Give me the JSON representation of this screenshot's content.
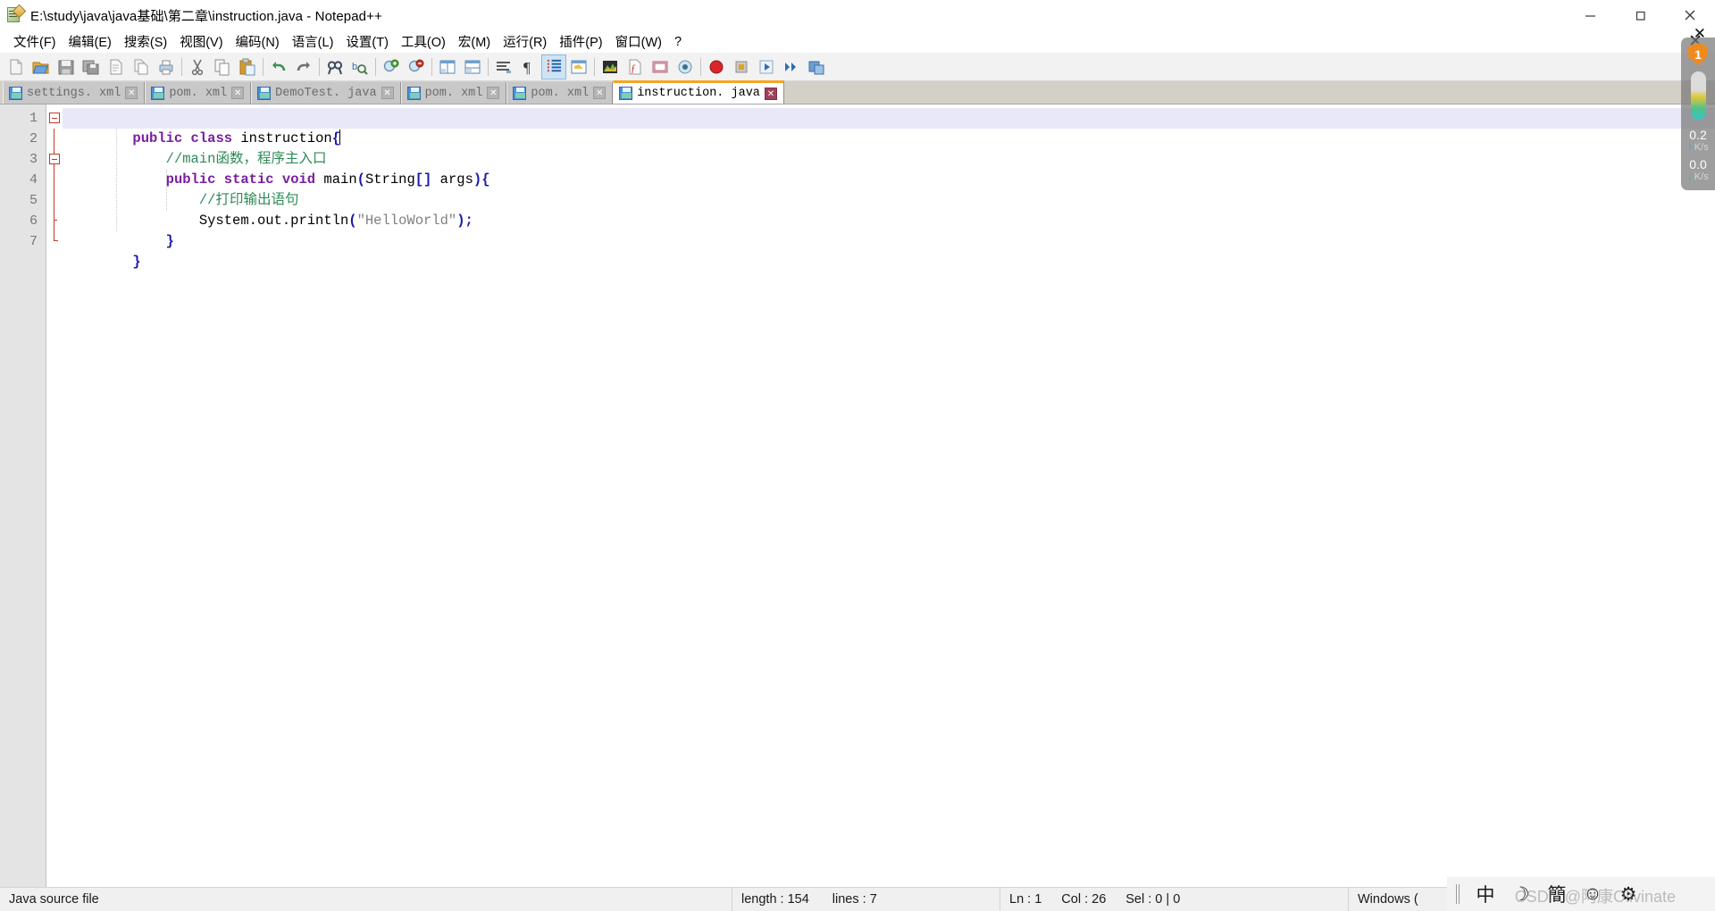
{
  "window": {
    "title": "E:\\study\\java\\java基础\\第二章\\instruction.java - Notepad++",
    "icon": "notepadpp-icon",
    "minimize_label": "—",
    "maximize_label": "▢",
    "close_label": "✕"
  },
  "menu": {
    "items": [
      {
        "label": "文件(F)",
        "name": "menu-file"
      },
      {
        "label": "编辑(E)",
        "name": "menu-edit"
      },
      {
        "label": "搜索(S)",
        "name": "menu-search"
      },
      {
        "label": "视图(V)",
        "name": "menu-view"
      },
      {
        "label": "编码(N)",
        "name": "menu-encoding"
      },
      {
        "label": "语言(L)",
        "name": "menu-language"
      },
      {
        "label": "设置(T)",
        "name": "menu-settings"
      },
      {
        "label": "工具(O)",
        "name": "menu-tools"
      },
      {
        "label": "宏(M)",
        "name": "menu-macro"
      },
      {
        "label": "运行(R)",
        "name": "menu-run"
      },
      {
        "label": "插件(P)",
        "name": "menu-plugins"
      },
      {
        "label": "窗口(W)",
        "name": "menu-window"
      },
      {
        "label": "?",
        "name": "menu-help"
      }
    ],
    "close_doc_label": "✕"
  },
  "toolbar": {
    "buttons": [
      "new-file-icon",
      "open-file-icon",
      "save-icon",
      "save-all-icon",
      "close-file-icon",
      "close-all-icon",
      "print-icon",
      "cut-icon",
      "copy-icon",
      "paste-icon",
      "undo-icon",
      "redo-icon",
      "find-icon",
      "replace-icon",
      "zoom-in-icon",
      "zoom-out-icon",
      "sync-vertical-icon",
      "sync-horizontal-icon",
      "word-wrap-icon",
      "show-all-chars-icon",
      "indent-guide-icon",
      "ui-user-defined-dialog-icon",
      "show-doc-map-icon",
      "function-list-icon",
      "folder-as-workspace-icon",
      "monitoring-icon",
      "record-macro-icon",
      "stop-macro-icon",
      "play-macro-icon",
      "fast-play-macro-icon",
      "save-macro-icon"
    ]
  },
  "tabs": [
    {
      "label": "settings. xml",
      "name": "tab-settings-xml",
      "active": false
    },
    {
      "label": "pom. xml",
      "name": "tab-pom-xml-1",
      "active": false
    },
    {
      "label": "DemoTest. java",
      "name": "tab-demotest-java",
      "active": false
    },
    {
      "label": "pom. xml",
      "name": "tab-pom-xml-2",
      "active": false
    },
    {
      "label": "pom. xml",
      "name": "tab-pom-xml-3",
      "active": false
    },
    {
      "label": "instruction. java",
      "name": "tab-instruction-java",
      "active": true
    }
  ],
  "editor": {
    "line_numbers": [
      "1",
      "2",
      "3",
      "4",
      "5",
      "6",
      "7"
    ],
    "lines": [
      {
        "n": 1,
        "current": true,
        "tokens": [
          {
            "t": "public",
            "c": "kw"
          },
          {
            "t": " ",
            "c": "plain"
          },
          {
            "t": "class",
            "c": "kw"
          },
          {
            "t": " instruction",
            "c": "plain"
          },
          {
            "t": "{",
            "c": "brace"
          }
        ]
      },
      {
        "n": 2,
        "current": false,
        "tokens": [
          {
            "t": "    ",
            "c": "plain"
          },
          {
            "t": "//main函数，程序主入口",
            "c": "comment"
          }
        ]
      },
      {
        "n": 3,
        "current": false,
        "tokens": [
          {
            "t": "    ",
            "c": "plain"
          },
          {
            "t": "public",
            "c": "kw"
          },
          {
            "t": " ",
            "c": "plain"
          },
          {
            "t": "static",
            "c": "kw"
          },
          {
            "t": " ",
            "c": "plain"
          },
          {
            "t": "void",
            "c": "kw"
          },
          {
            "t": " main",
            "c": "plain"
          },
          {
            "t": "(",
            "c": "brkt"
          },
          {
            "t": "String",
            "c": "plain"
          },
          {
            "t": "[]",
            "c": "brkt"
          },
          {
            "t": " args",
            "c": "plain"
          },
          {
            "t": ")",
            "c": "brkt"
          },
          {
            "t": "{",
            "c": "brace"
          }
        ]
      },
      {
        "n": 4,
        "current": false,
        "tokens": [
          {
            "t": "        ",
            "c": "plain"
          },
          {
            "t": "//打印输出语句",
            "c": "comment"
          }
        ]
      },
      {
        "n": 5,
        "current": false,
        "tokens": [
          {
            "t": "        System.out.println",
            "c": "plain"
          },
          {
            "t": "(",
            "c": "brkt"
          },
          {
            "t": "\"HelloWorld\"",
            "c": "str"
          },
          {
            "t": ")",
            "c": "brkt"
          },
          {
            "t": ";",
            "c": "brkt"
          }
        ]
      },
      {
        "n": 6,
        "current": false,
        "tokens": [
          {
            "t": "    ",
            "c": "plain"
          },
          {
            "t": "}",
            "c": "brace"
          }
        ]
      },
      {
        "n": 7,
        "current": false,
        "tokens": [
          {
            "t": "}",
            "c": "brace"
          }
        ]
      }
    ],
    "caret_line": 1,
    "colors": {
      "keyword": "#7a1ea1",
      "comment": "#2e8b57",
      "string": "#808080",
      "bracket": "#1a1aa8",
      "current_line_bg": "#e8e8f8",
      "gutter_bg": "#e4e4e4",
      "fold_marker": "#c1392b",
      "active_tab_accent": "#f5a623"
    }
  },
  "status": {
    "file_type": "Java source file",
    "length_label": "length : 154",
    "lines_label": "lines : 7",
    "ln_label": "Ln : 1",
    "col_label": "Col : 26",
    "sel_label": "Sel : 0 | 0",
    "eol_label": "Windows ("
  },
  "tray": {
    "grip": "drag-grip",
    "items": [
      {
        "glyph": "中",
        "name": "ime-chinese-icon"
      },
      {
        "glyph": "☽",
        "name": "moon-mode-icon"
      },
      {
        "glyph": "簡",
        "name": "traditional-simplified-icon"
      },
      {
        "glyph": "☺",
        "name": "emoji-icon"
      },
      {
        "glyph": "⚙",
        "name": "ime-settings-icon"
      }
    ],
    "watermark": "CSDN @阿康Olivinate"
  },
  "speed_widget": {
    "shield_badge": "1",
    "upload_value": "0.2",
    "upload_unit": "K/s",
    "upload_arrow": "↑",
    "download_value": "0.0",
    "download_unit": "K/s",
    "download_arrow": "↓"
  }
}
